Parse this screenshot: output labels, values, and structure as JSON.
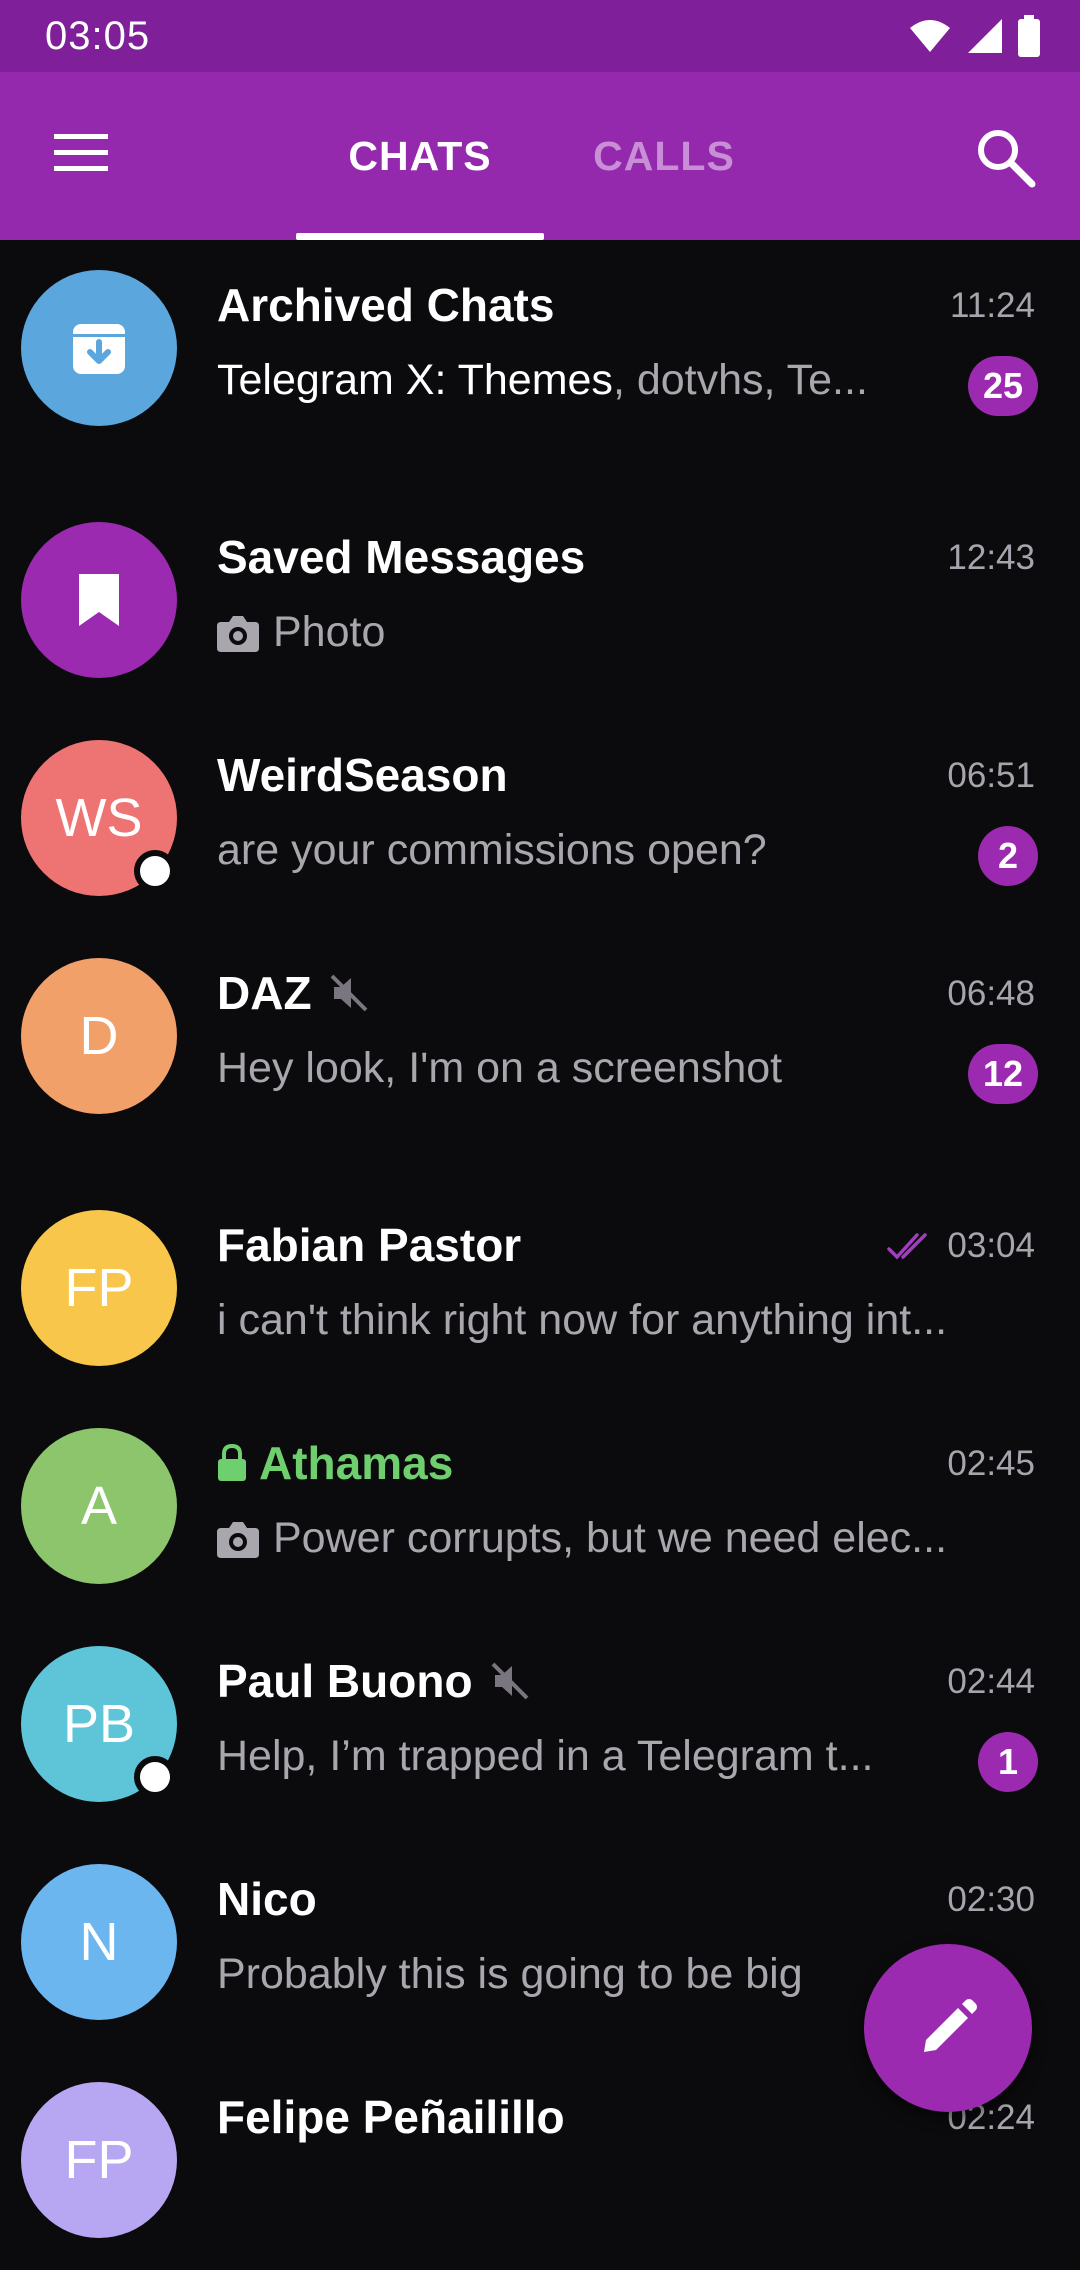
{
  "status_bar": {
    "time": "03:05",
    "icons": [
      "wifi-icon",
      "signal-icon",
      "battery-icon"
    ]
  },
  "app_bar": {
    "tabs": [
      {
        "label": "CHATS",
        "active": true
      },
      {
        "label": "CALLS",
        "active": false
      }
    ],
    "menu_icon": "menu-icon",
    "search_icon": "search-icon"
  },
  "colors": {
    "status_bar": "#7f1f99",
    "app_bar": "#9429ae",
    "accent": "#9b2ab0",
    "secure": "#6fcf6f"
  },
  "chats": [
    {
      "name": "Archived Chats",
      "time": "11:24",
      "preview_highlight": "Telegram X: Themes",
      "preview": ", dotvhs, Te...",
      "badge": "25",
      "avatar_icon": "archive-icon",
      "avatar_color": "#5aa6dd"
    },
    {
      "name": "Saved Messages",
      "time": "12:43",
      "preview": "Photo",
      "preview_icon": "camera-icon",
      "avatar_icon": "bookmark-icon",
      "avatar_color": "#9b2ab0"
    },
    {
      "name": "WeirdSeason",
      "time": "06:51",
      "preview": "are your commissions open?",
      "badge": "2",
      "initials": "WS",
      "avatar_color": "#ee7474",
      "online": true
    },
    {
      "name": "DAZ",
      "muted": true,
      "time": "06:48",
      "preview": "Hey look, I'm on a screenshot",
      "badge": "12",
      "initials": "D",
      "avatar_color": "#f2a06a"
    },
    {
      "name": "Fabian Pastor",
      "time": "03:04",
      "read": true,
      "preview": "i can't think right now for anything int...",
      "initials": "FP",
      "avatar_color": "#f7c64a"
    },
    {
      "name": "Athamas",
      "secret": true,
      "time": "02:45",
      "preview": "Power corrupts, but we need elec...",
      "preview_icon": "camera-icon",
      "initials": "A",
      "avatar_color": "#8cc56c"
    },
    {
      "name": "Paul Buono",
      "muted": true,
      "time": "02:44",
      "preview": "Help, I’m trapped in a Telegram t...",
      "badge": "1",
      "initials": "PB",
      "avatar_color": "#5ec4d8",
      "online": true
    },
    {
      "name": "Nico",
      "time": "02:30",
      "preview": "Probably this is going to be big",
      "initials": "N",
      "avatar_color": "#6cb6f0"
    },
    {
      "name": "Felipe Peñailillo",
      "time": "02:24",
      "initials": "FP",
      "avatar_color": "#b7a7f2"
    }
  ],
  "fab": {
    "icon": "pencil-icon"
  }
}
